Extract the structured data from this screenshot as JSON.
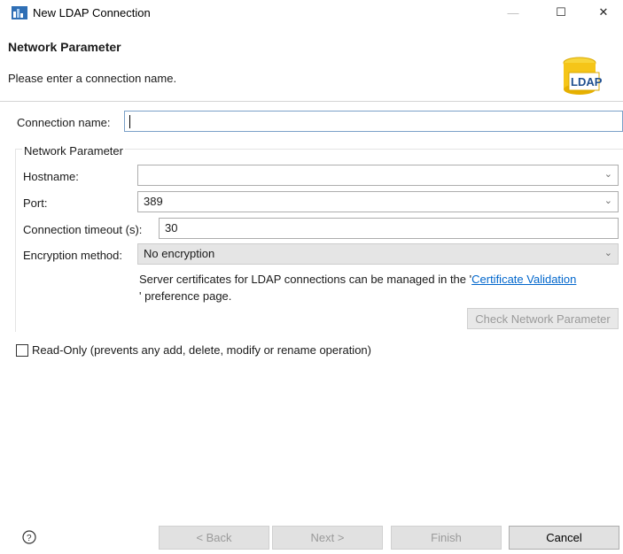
{
  "window": {
    "title": "New LDAP Connection",
    "minimize_label": "—",
    "maximize_label": "☐",
    "close_label": "✕"
  },
  "header": {
    "title": "Network Parameter",
    "message": "Please enter a connection name.",
    "logo_text": "LDAP"
  },
  "connection": {
    "label": "Connection name:",
    "value": ""
  },
  "network_group": {
    "label": "Network Parameter",
    "hostname_label": "Hostname:",
    "hostname_value": "",
    "port_label": "Port:",
    "port_value": "389",
    "timeout_label": "Connection timeout (s):",
    "timeout_value": "30",
    "encryption_label": "Encryption method:",
    "encryption_value": "No encryption",
    "info_prefix": "Server certificates for LDAP connections can be managed in the '",
    "info_link": "Certificate Validation",
    "info_suffix": "' preference page.",
    "check_button": "Check Network Parameter"
  },
  "readonly": {
    "label": "Read-Only (prevents any add, delete, modify or rename operation)",
    "checked": false
  },
  "footer": {
    "help_icon": "question-circle-icon",
    "back": "< Back",
    "next": "Next >",
    "finish": "Finish",
    "cancel": "Cancel"
  },
  "colors": {
    "link": "#0066cc",
    "focus_border": "#7aa0c8",
    "disabled_text": "#9a9a9a"
  }
}
